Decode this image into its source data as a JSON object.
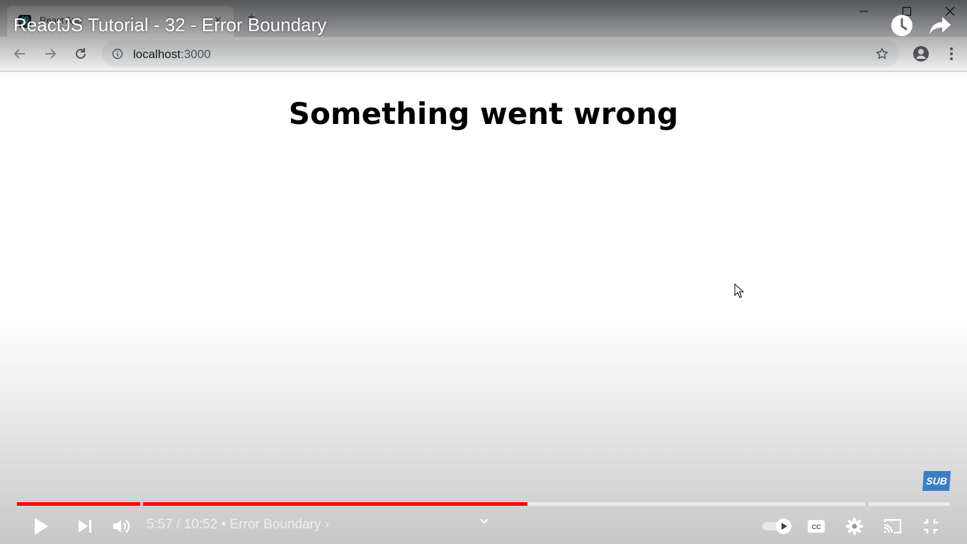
{
  "browser": {
    "tab_title": "React App",
    "url_host": "localhost",
    "url_port": ":3000"
  },
  "page": {
    "heading": "Something went wrong"
  },
  "player": {
    "video_title": "ReactJS Tutorial - 32 - Error Boundary",
    "current_time": "5:57",
    "time_separator": "/",
    "duration": "10:52",
    "chapter_bullet": "•",
    "chapter_title": "Error Boundary",
    "chapter_arrow": "›",
    "progress_fraction": 0.547,
    "sub_badge": "SUB",
    "accent_color": "#ff0000",
    "icons": [
      "watch-later-icon",
      "share-icon",
      "play-icon",
      "next-icon",
      "volume-icon",
      "autoplay-toggle",
      "captions-icon",
      "settings-icon",
      "cast-icon",
      "exit-fullscreen-icon"
    ]
  }
}
